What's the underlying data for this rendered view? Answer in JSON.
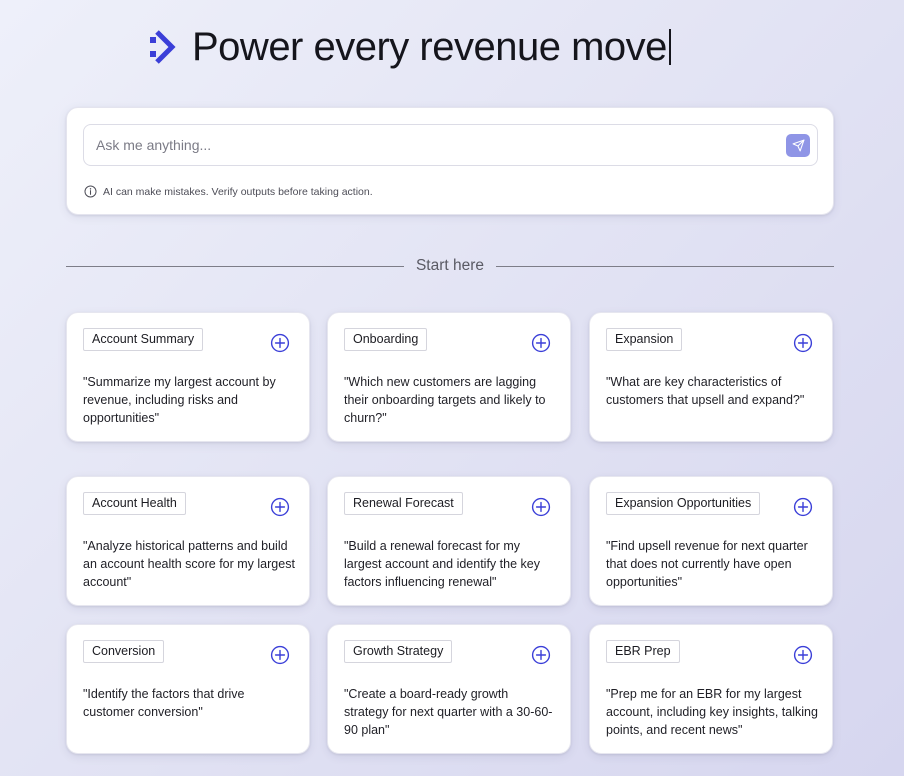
{
  "hero": {
    "title": "Power every revenue move"
  },
  "ask": {
    "placeholder": "Ask me anything...",
    "disclaimer": "AI can make mistakes. Verify outputs before taking action."
  },
  "section": {
    "label": "Start here"
  },
  "colors": {
    "accent": "#3b3fd8",
    "send": "#8f95e6"
  },
  "cards": [
    {
      "tag": "Account Summary",
      "prompt": "\"Summarize my largest account by revenue, including risks and opportunities\""
    },
    {
      "tag": "Onboarding",
      "prompt": "\"Which new customers are lagging their onboarding targets and likely to churn?\""
    },
    {
      "tag": "Expansion",
      "prompt": "\"What are key characteristics of customers that upsell and expand?\""
    },
    {
      "tag": "Account Health",
      "prompt": "\"Analyze historical patterns and build an account health score for my largest account\""
    },
    {
      "tag": "Renewal Forecast",
      "prompt": "\"Build a renewal forecast for my largest account and identify the key factors influencing renewal\""
    },
    {
      "tag": "Expansion Opportunities",
      "prompt": "\"Find upsell revenue for next quarter that does not currently have open opportunities\""
    },
    {
      "tag": "Conversion",
      "prompt": "\"Identify the factors that drive customer conversion\""
    },
    {
      "tag": "Growth Strategy",
      "prompt": "\"Create a board-ready growth strategy for next quarter with a 30-60-90 plan\""
    },
    {
      "tag": "EBR Prep",
      "prompt": "\"Prep me for an EBR for my largest account, including key insights, talking points, and recent news\""
    }
  ]
}
